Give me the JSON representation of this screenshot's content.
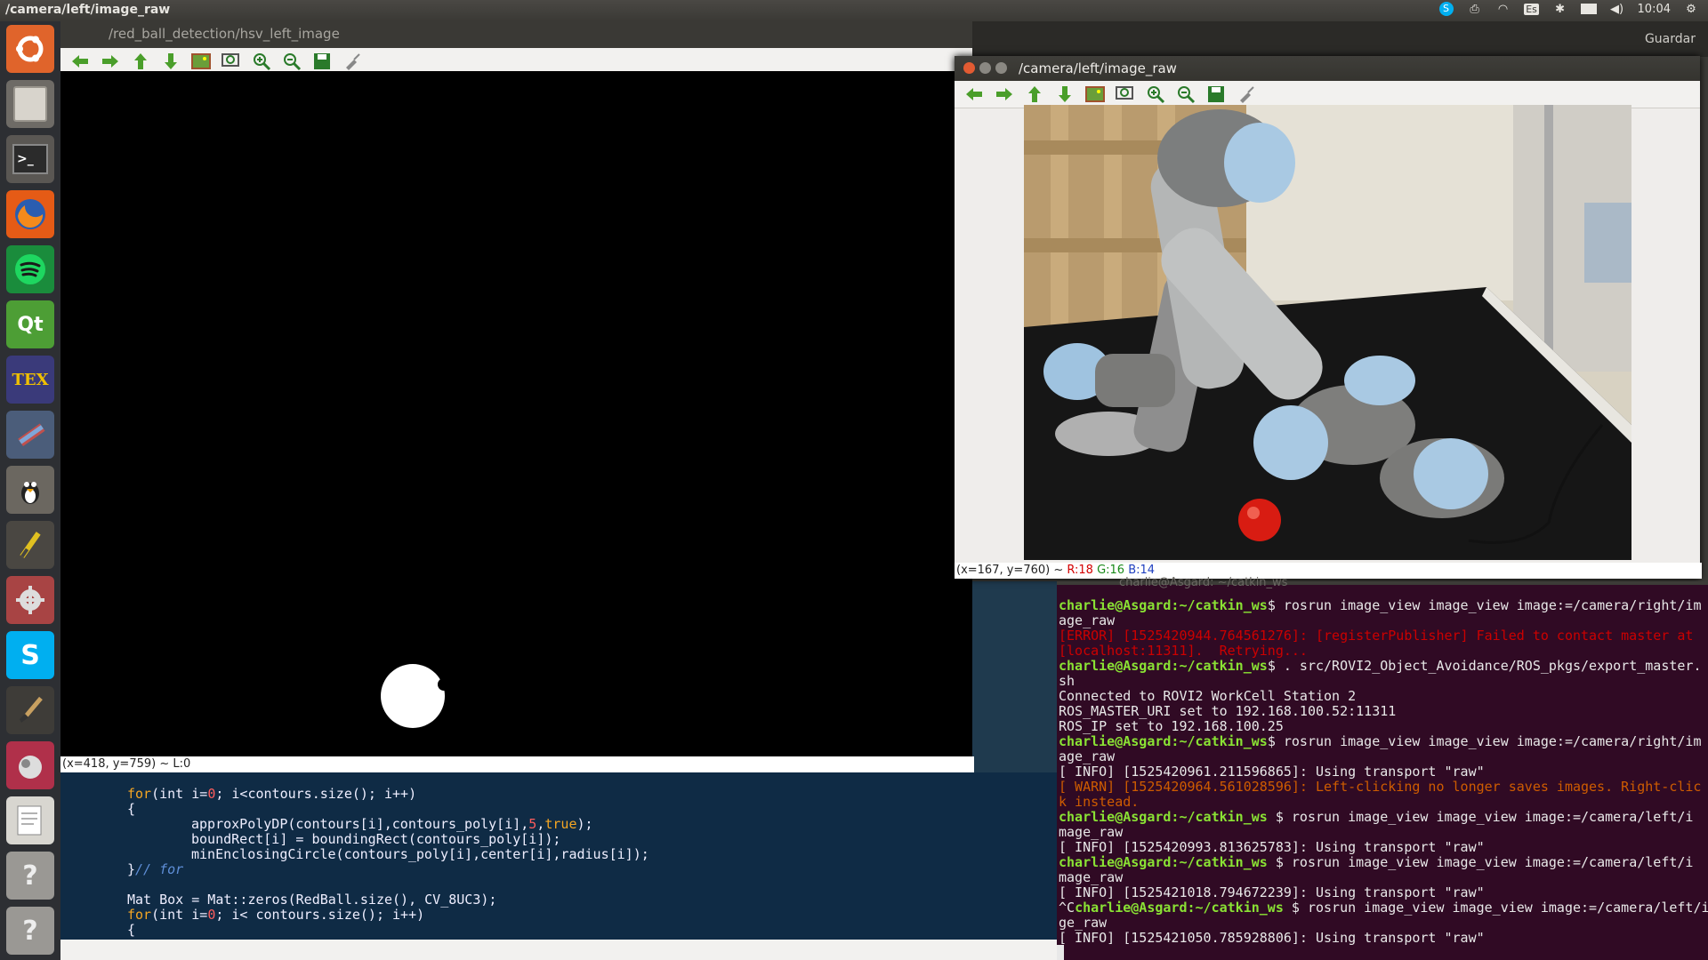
{
  "topbar": {
    "title": "/camera/left/image_raw",
    "keyboard": "Es",
    "time": "10:04",
    "tray_icons": [
      "skype-icon",
      "printer-icon",
      "wifi-icon",
      "keyboard-icon",
      "bluetooth-icon",
      "battery-icon",
      "volume-icon"
    ]
  },
  "launcher": {
    "apps": [
      "ubuntu-logo-icon",
      "files-icon",
      "terminal-icon",
      "firefox-icon",
      "spotify-icon",
      "qt-creator-icon",
      "texmaker-icon",
      "qtcreator-tool-icon",
      "gimp-icon",
      "editor-icon",
      "settings-icon",
      "skype-icon",
      "paint-brush-icon",
      "ros-icon",
      "text-editor-icon",
      "unknown-app-icon",
      "unknown-app-icon"
    ],
    "qt_label": "Qt",
    "tex_label": "TEX"
  },
  "hsv_window": {
    "title": "/red_ball_detection/hsv_left_image",
    "status": "(x=418, y=759) ~ L:0",
    "toolbar": [
      "back-arrow-icon",
      "forward-arrow-icon",
      "up-arrow-icon",
      "down-arrow-icon",
      "image-icon",
      "zoom-fit-icon",
      "zoom-in-icon",
      "zoom-out-icon",
      "save-icon",
      "clear-icon"
    ]
  },
  "camera_window": {
    "title": "/camera/left/image_raw",
    "status_prefix": "(x=167, y=760) ~ ",
    "status_r": "R:18",
    "status_g": "G:16",
    "status_b": "B:14"
  },
  "right_panel": {
    "guardar": "Guardar"
  },
  "editor": {
    "lines": [
      "for(int i=0; i<contours.size(); i++)",
      "{",
      "approxPolyDP(contours[i],contours_poly[i],5,true);",
      "boundRect[i] = boundingRect(contours_poly[i]);",
      "minEnclosingCircle(contours_poly[i],center[i],radius[i]);",
      "}// for",
      "",
      "Mat Box = Mat::zeros(RedBall.size(), CV_8UC3);",
      "for(int i=0; i< contours.size(); i++)",
      "{"
    ]
  },
  "terminal": {
    "title": "charlie@Asgard: ~/catkin_ws",
    "prompt": "charlie@Asgard:~/catkin_ws",
    "lines": [
      {
        "type": "cmd",
        "text": "$ rosrun image_view image_view image:=/camera/right/im"
      },
      {
        "type": "out",
        "text": "age_raw"
      },
      {
        "type": "err",
        "text": "[ERROR] [1525420944.764561276]: [registerPublisher] Failed to contact master at"
      },
      {
        "type": "err",
        "text": "[localhost:11311].  Retrying..."
      },
      {
        "type": "cmd",
        "text": "$ . src/ROVI2_Object_Avoidance/ROS_pkgs/export_master."
      },
      {
        "type": "out",
        "text": "sh"
      },
      {
        "type": "out",
        "text": "Connected to ROVI2 WorkCell Station 2"
      },
      {
        "type": "out",
        "text": "ROS_MASTER_URI set to 192.168.100.52:11311"
      },
      {
        "type": "out",
        "text": "ROS_IP set to 192.168.100.25"
      },
      {
        "type": "cmd",
        "text": "$ rosrun image_view image_view image:=/camera/right/im"
      },
      {
        "type": "out",
        "text": "age_raw"
      },
      {
        "type": "out",
        "text": "[ INFO] [1525420961.211596865]: Using transport \"raw\""
      },
      {
        "type": "warn",
        "text": "[ WARN] [1525420964.561028596]: Left-clicking no longer saves images. Right-clic"
      },
      {
        "type": "warn",
        "text": "k instead."
      },
      {
        "type": "cmd",
        "text": " $ rosrun image_view image_view image:=/camera/left/i"
      },
      {
        "type": "out",
        "text": "mage_raw"
      },
      {
        "type": "out",
        "text": "[ INFO] [1525420993.813625783]: Using transport \"raw\""
      },
      {
        "type": "cmd",
        "text": " $ rosrun image_view image_view image:=/camera/left/i"
      },
      {
        "type": "out",
        "text": "mage_raw"
      },
      {
        "type": "out",
        "text": "[ INFO] [1525421018.794672239]: Using transport \"raw\""
      },
      {
        "type": "cmd2",
        "text": " $ rosrun image_view image_view image:=/camera/left/i",
        "prefix": "^C"
      },
      {
        "type": "out",
        "text": "ge_raw"
      },
      {
        "type": "out",
        "text": "[ INFO] [1525421050.785928806]: Using transport \"raw\""
      }
    ]
  }
}
